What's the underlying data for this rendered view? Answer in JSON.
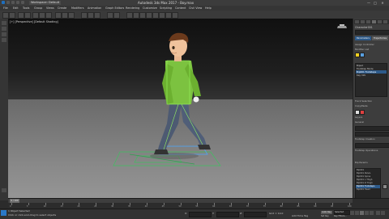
{
  "titlebar": {
    "workspace": "Workspace: Default",
    "title": "Autodesk 3ds Max 2017 - Boy.max",
    "minimize": "—",
    "maximize": "□",
    "close": "✕"
  },
  "menu": [
    "File",
    "Edit",
    "Tools",
    "Group",
    "Views",
    "Create",
    "Modifiers",
    "Animation",
    "Graph Editors",
    "Rendering",
    "Customize",
    "Scripting",
    "Content",
    "Civil View",
    "Help"
  ],
  "viewport": {
    "label": "[+] [Perspective] [Default Shading]"
  },
  "right_panel": {
    "object_name": "Character001",
    "tabs": [
      "Create",
      "Modify",
      "Hierarchy",
      "Motion",
      "Display",
      "Utilities"
    ],
    "buttons": [
      "Assign Controller",
      "Parameters",
      "Trajectories"
    ],
    "modifier_list_label": "Modifier List",
    "modifiers": [
      "Biped",
      "Footstep Mode",
      "Bip001 Footsteps",
      "Key Info"
    ],
    "selected_modifier": "Bip001 Footsteps",
    "rows": [
      "Track Selection",
      "Copy/Paste",
      "Layers",
      "General",
      "Footstep Creation",
      "Footstep Operations"
    ],
    "param_header": "Bip Params",
    "param_list": [
      "Bip001",
      "Bip001 Pelvis",
      "Bip001 Spine",
      "Bip001 L Thigh",
      "Bip001 R Thigh",
      "Bip001 Footsteps",
      "Bip001 Head"
    ],
    "param_selected": "Bip001 Footsteps",
    "swatch_colors": [
      "#f0d020",
      "#5aa0e0",
      "#e0e0e0",
      "#e04040"
    ]
  },
  "timeline": {
    "frame_display": "0 / 100",
    "ticks": [
      "0",
      "5",
      "10",
      "15",
      "20",
      "25",
      "30",
      "35",
      "40",
      "45",
      "50",
      "55",
      "60",
      "65",
      "70",
      "75",
      "80",
      "85",
      "90",
      "95",
      "100"
    ]
  },
  "status": {
    "selection": "1 Object Selected",
    "prompt": "Click or click-and-drag to select objects",
    "coord_x": "X:",
    "coord_y": "Y:",
    "coord_z": "Z:",
    "grid": "Grid = 10.0",
    "auto_key": "Auto Key",
    "set_key": "Set Key",
    "selected": "Selected",
    "key_filters": "Key Filters...",
    "time_tag": "Add Time Tag"
  },
  "colors": {
    "accent": "#2d5a8a",
    "viewport_bg": "#1f1f1f",
    "floor": "#8a8a8a",
    "character_shirt": "#7cc240",
    "character_pants": "#4d5a72"
  }
}
